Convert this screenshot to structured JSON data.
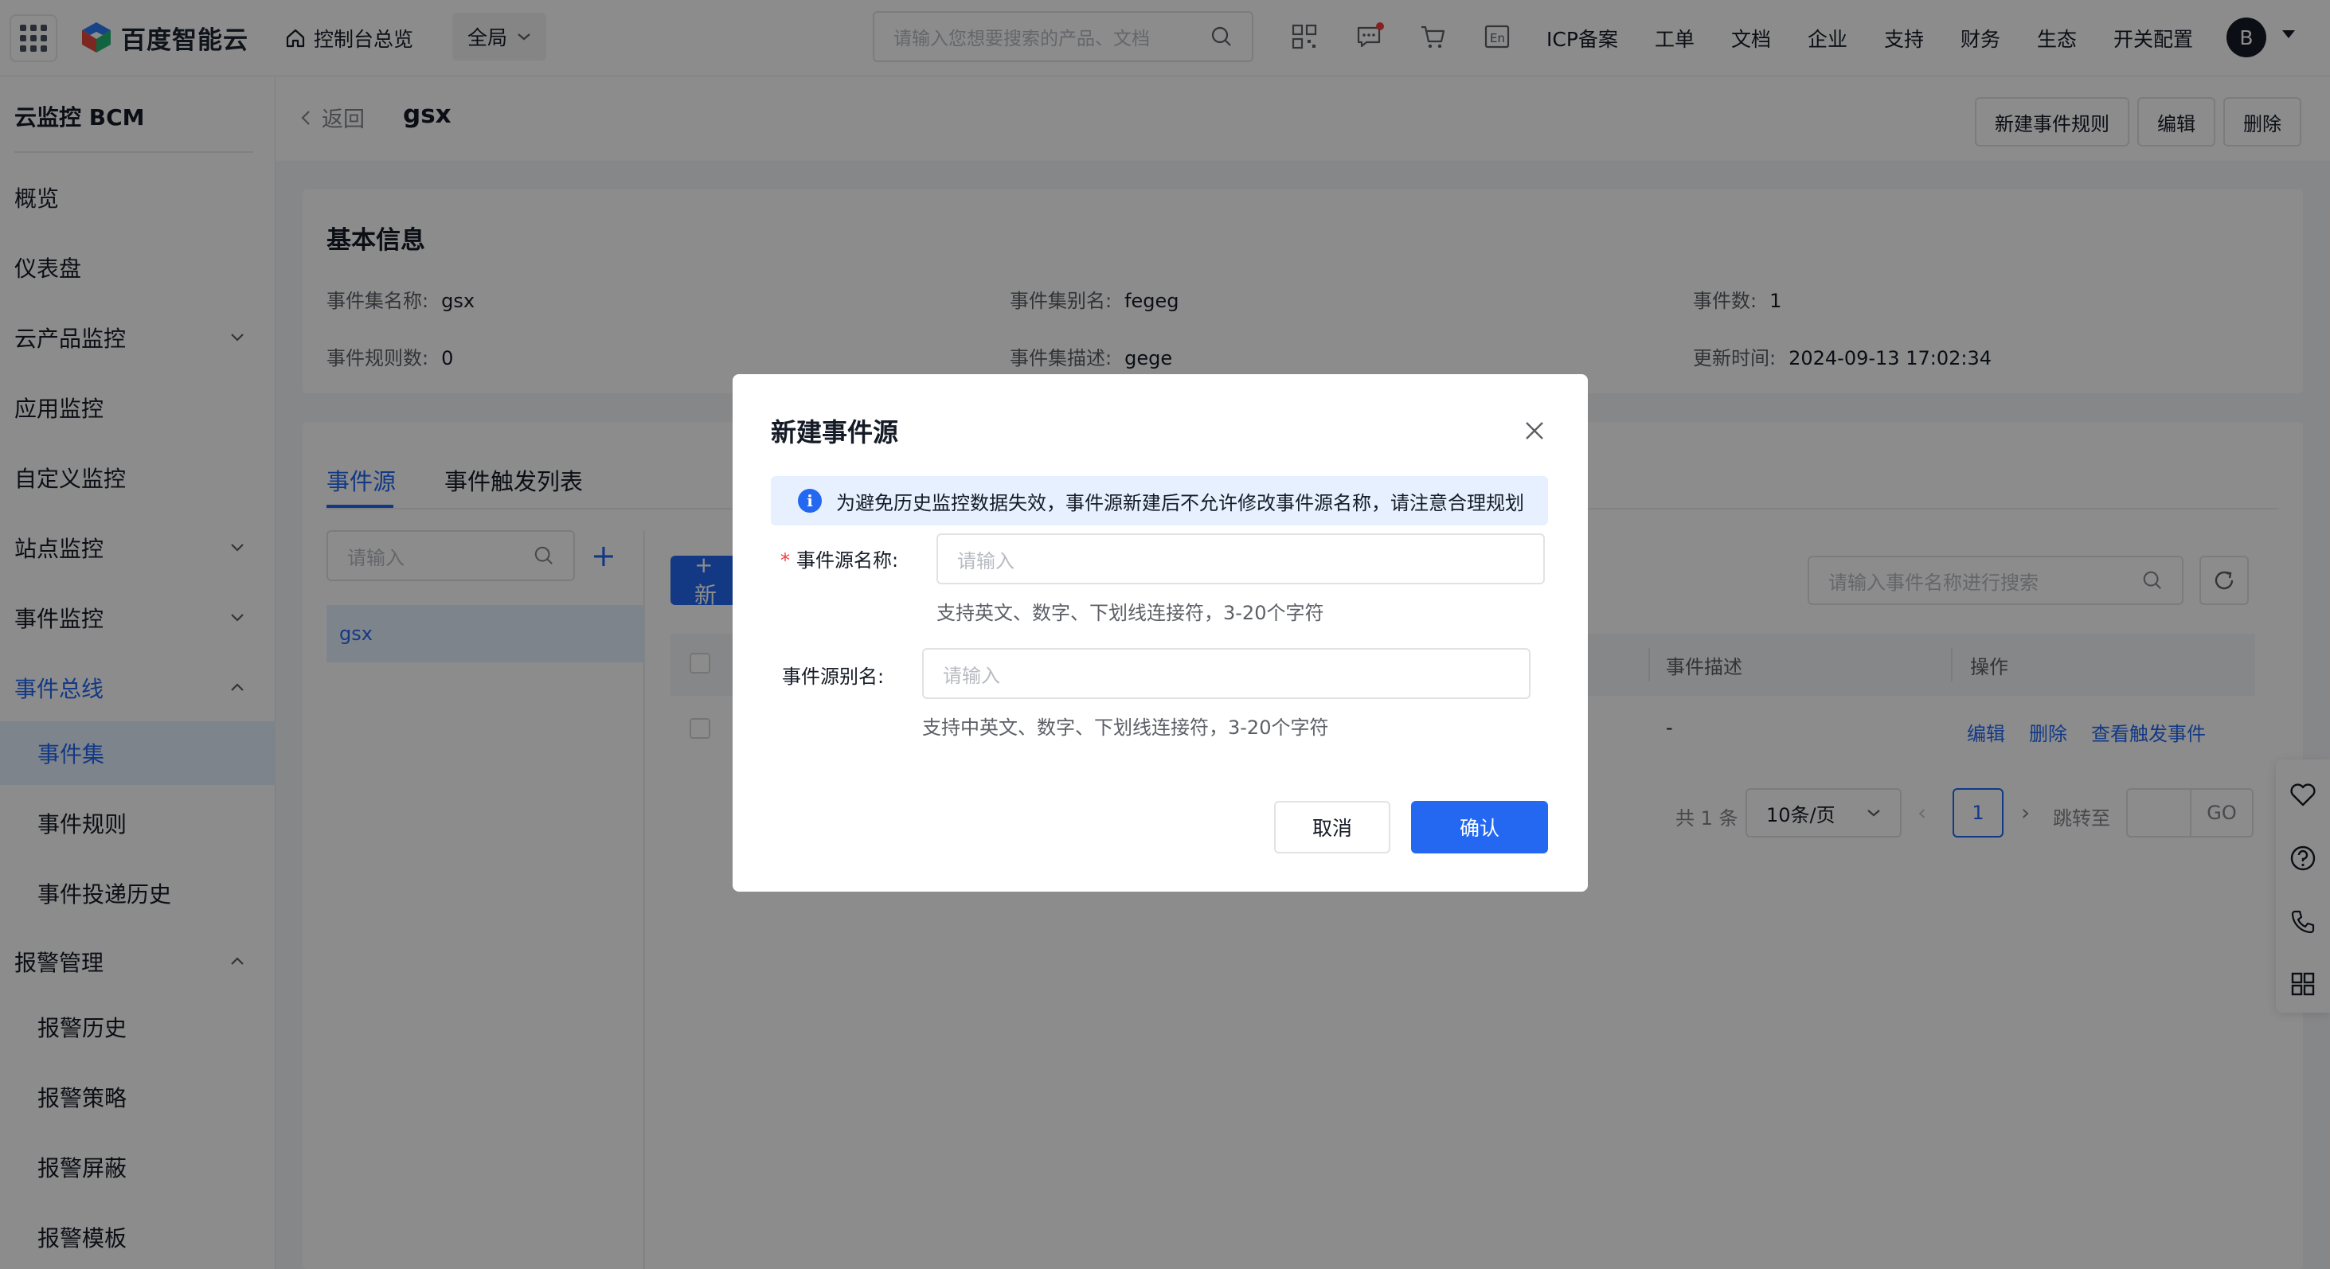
{
  "topbar": {
    "logo_text": "百度智能云",
    "home_label": "控制台总览",
    "scope_label": "全局",
    "search_placeholder": "请输入您想要搜索的产品、文档",
    "nav": [
      "ICP备案",
      "工单",
      "文档",
      "企业",
      "支持",
      "财务",
      "生态",
      "开关配置"
    ],
    "avatar_letter": "B",
    "icons": [
      "qrcode-icon",
      "message-icon",
      "cart-icon",
      "language-icon"
    ]
  },
  "sidebar": {
    "title": "云监控 BCM",
    "items": [
      {
        "label": "概览"
      },
      {
        "label": "仪表盘"
      },
      {
        "label": "云产品监控"
      },
      {
        "label": "应用监控"
      },
      {
        "label": "自定义监控"
      },
      {
        "label": "站点监控"
      },
      {
        "label": "事件监控"
      },
      {
        "label": "事件总线"
      },
      {
        "label": "事件集"
      },
      {
        "label": "事件规则"
      },
      {
        "label": "事件投递历史"
      },
      {
        "label": "报警管理"
      },
      {
        "label": "报警历史"
      },
      {
        "label": "报警策略"
      },
      {
        "label": "报警屏蔽"
      },
      {
        "label": "报警模板"
      }
    ]
  },
  "page": {
    "back_label": "返回",
    "name": "gsx",
    "buttons": {
      "new_rule": "新建事件规则",
      "edit": "编辑",
      "delete": "删除"
    }
  },
  "basic_info": {
    "title": "基本信息",
    "fields": [
      {
        "key": "事件集名称:",
        "value": "gsx"
      },
      {
        "key": "事件集别名:",
        "value": "fegeg"
      },
      {
        "key": "事件数:",
        "value": "1"
      },
      {
        "key": "事件规则数:",
        "value": "0"
      },
      {
        "key": "事件集描述:",
        "value": "gege"
      },
      {
        "key": "更新时间:",
        "value": "2024-09-13 17:02:34"
      }
    ]
  },
  "tabs": [
    "事件源",
    "事件触发列表"
  ],
  "left_panel": {
    "search_placeholder": "请输入",
    "add_symbol": "+",
    "item": "gsx"
  },
  "table": {
    "new_button_symbol": "+ 新",
    "search_placeholder": "请输入事件名称进行搜索",
    "headers": [
      "事件描述",
      "操作"
    ],
    "row": {
      "description": "-",
      "actions": [
        "编辑",
        "删除",
        "查看触发事件"
      ]
    }
  },
  "pagination": {
    "total": "共 1 条",
    "page_size": "10条/页",
    "prev": "‹",
    "current": "1",
    "next": "›",
    "jump_label": "跳转至",
    "go": "GO"
  },
  "modal": {
    "title": "新建事件源",
    "alert": "为避免历史监控数据失效，事件源新建后不允许修改事件源名称，请注意合理规划",
    "alert_icon_text": "i",
    "name_required_mark": "*",
    "name_label": "事件源名称:",
    "name_placeholder": "请输入",
    "name_hint": "支持英文、数字、下划线连接符，3-20个字符",
    "alias_label": "事件源别名:",
    "alias_placeholder": "请输入",
    "alias_hint": "支持中英文、数字、下划线连接符，3-20个字符",
    "cancel": "取消",
    "confirm": "确认"
  },
  "colors": {
    "accent": "#2468f2",
    "required": "#f33e3e",
    "mask": "rgba(0,0,0,0.45)"
  }
}
